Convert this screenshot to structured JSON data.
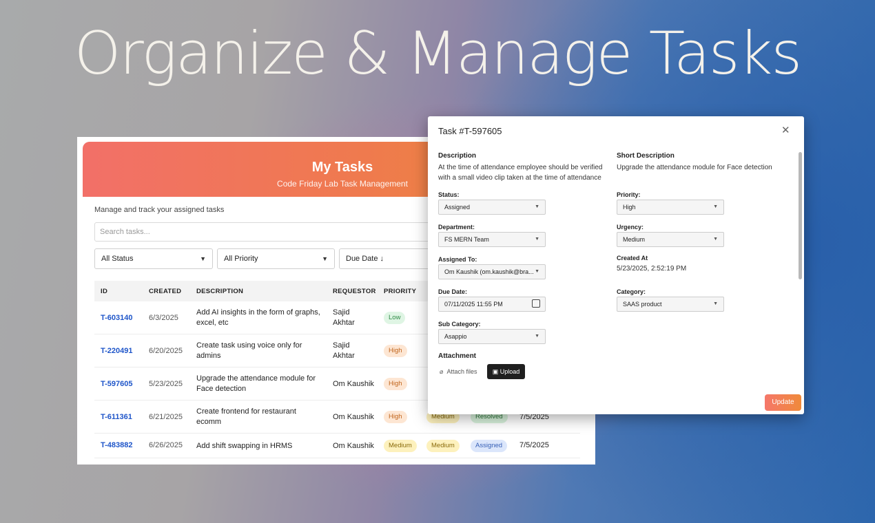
{
  "headline": "Organize & Manage Tasks",
  "app": {
    "title": "My Tasks",
    "subtitle": "Code Friday Lab Task Management",
    "description": "Manage and track your assigned tasks",
    "search_placeholder": "Search tasks...",
    "filters": {
      "status": "All Status",
      "priority": "All Priority",
      "sort": "Due Date ↓"
    },
    "columns": [
      "ID",
      "CREATED",
      "DESCRIPTION",
      "REQUESTOR",
      "PRIORITY"
    ],
    "rows": [
      {
        "id": "T-603140",
        "created": "6/3/2025",
        "description": "Add AI insights in the form of graphs, excel, etc",
        "requestor": "Sajid Akhtar",
        "priority": "Low",
        "urgency": "",
        "status": "",
        "due": ""
      },
      {
        "id": "T-220491",
        "created": "6/20/2025",
        "description": "Create task using voice only for admins",
        "requestor": "Sajid Akhtar",
        "priority": "High",
        "urgency": "",
        "status": "",
        "due": ""
      },
      {
        "id": "T-597605",
        "created": "5/23/2025",
        "description": "Upgrade the attendance module for Face detection",
        "requestor": "Om Kaushik",
        "priority": "High",
        "urgency": "",
        "status": "",
        "due": ""
      },
      {
        "id": "T-611361",
        "created": "6/21/2025",
        "description": "Create frontend for restaurant ecomm",
        "requestor": "Om Kaushik",
        "priority": "High",
        "urgency": "Medium",
        "status": "Resolved",
        "due": "7/5/2025"
      },
      {
        "id": "T-483882",
        "created": "6/26/2025",
        "description": "Add shift swapping in HRMS",
        "requestor": "Om Kaushik",
        "priority": "Medium",
        "urgency": "Medium",
        "status": "Assigned",
        "due": "7/5/2025"
      }
    ]
  },
  "modal": {
    "title": "Task #T-597605",
    "close": "✕",
    "description_label": "Description",
    "description_text": "At the time of attendance employee should be verified with a small video clip taken at the time of attendance",
    "short_description_label": "Short Description",
    "short_description_text": "Upgrade the attendance module for Face detection",
    "status_label": "Status:",
    "status_value": "Assigned",
    "priority_label": "Priority:",
    "priority_value": "High",
    "department_label": "Department:",
    "department_value": "FS MERN Team",
    "urgency_label": "Urgency:",
    "urgency_value": "Medium",
    "assigned_label": "Assigned To:",
    "assigned_value": "Om Kaushik (om.kaushik@bra...",
    "created_at_label": "Created At",
    "created_at_value": "5/23/2025, 2:52:19 PM",
    "due_label": "Due Date:",
    "due_value": "07/11/2025 11:55 PM",
    "category_label": "Category:",
    "category_value": "SAAS product",
    "subcategory_label": "Sub Category:",
    "subcategory_value": "Asappio",
    "attachment_label": "Attachment",
    "attach_files": "Attach files",
    "upload": "Upload",
    "update": "Update"
  },
  "icons": [
    "chevron-down-icon",
    "close-icon",
    "calendar-icon",
    "paperclip-icon",
    "upload-icon",
    "arrow-down-icon"
  ]
}
